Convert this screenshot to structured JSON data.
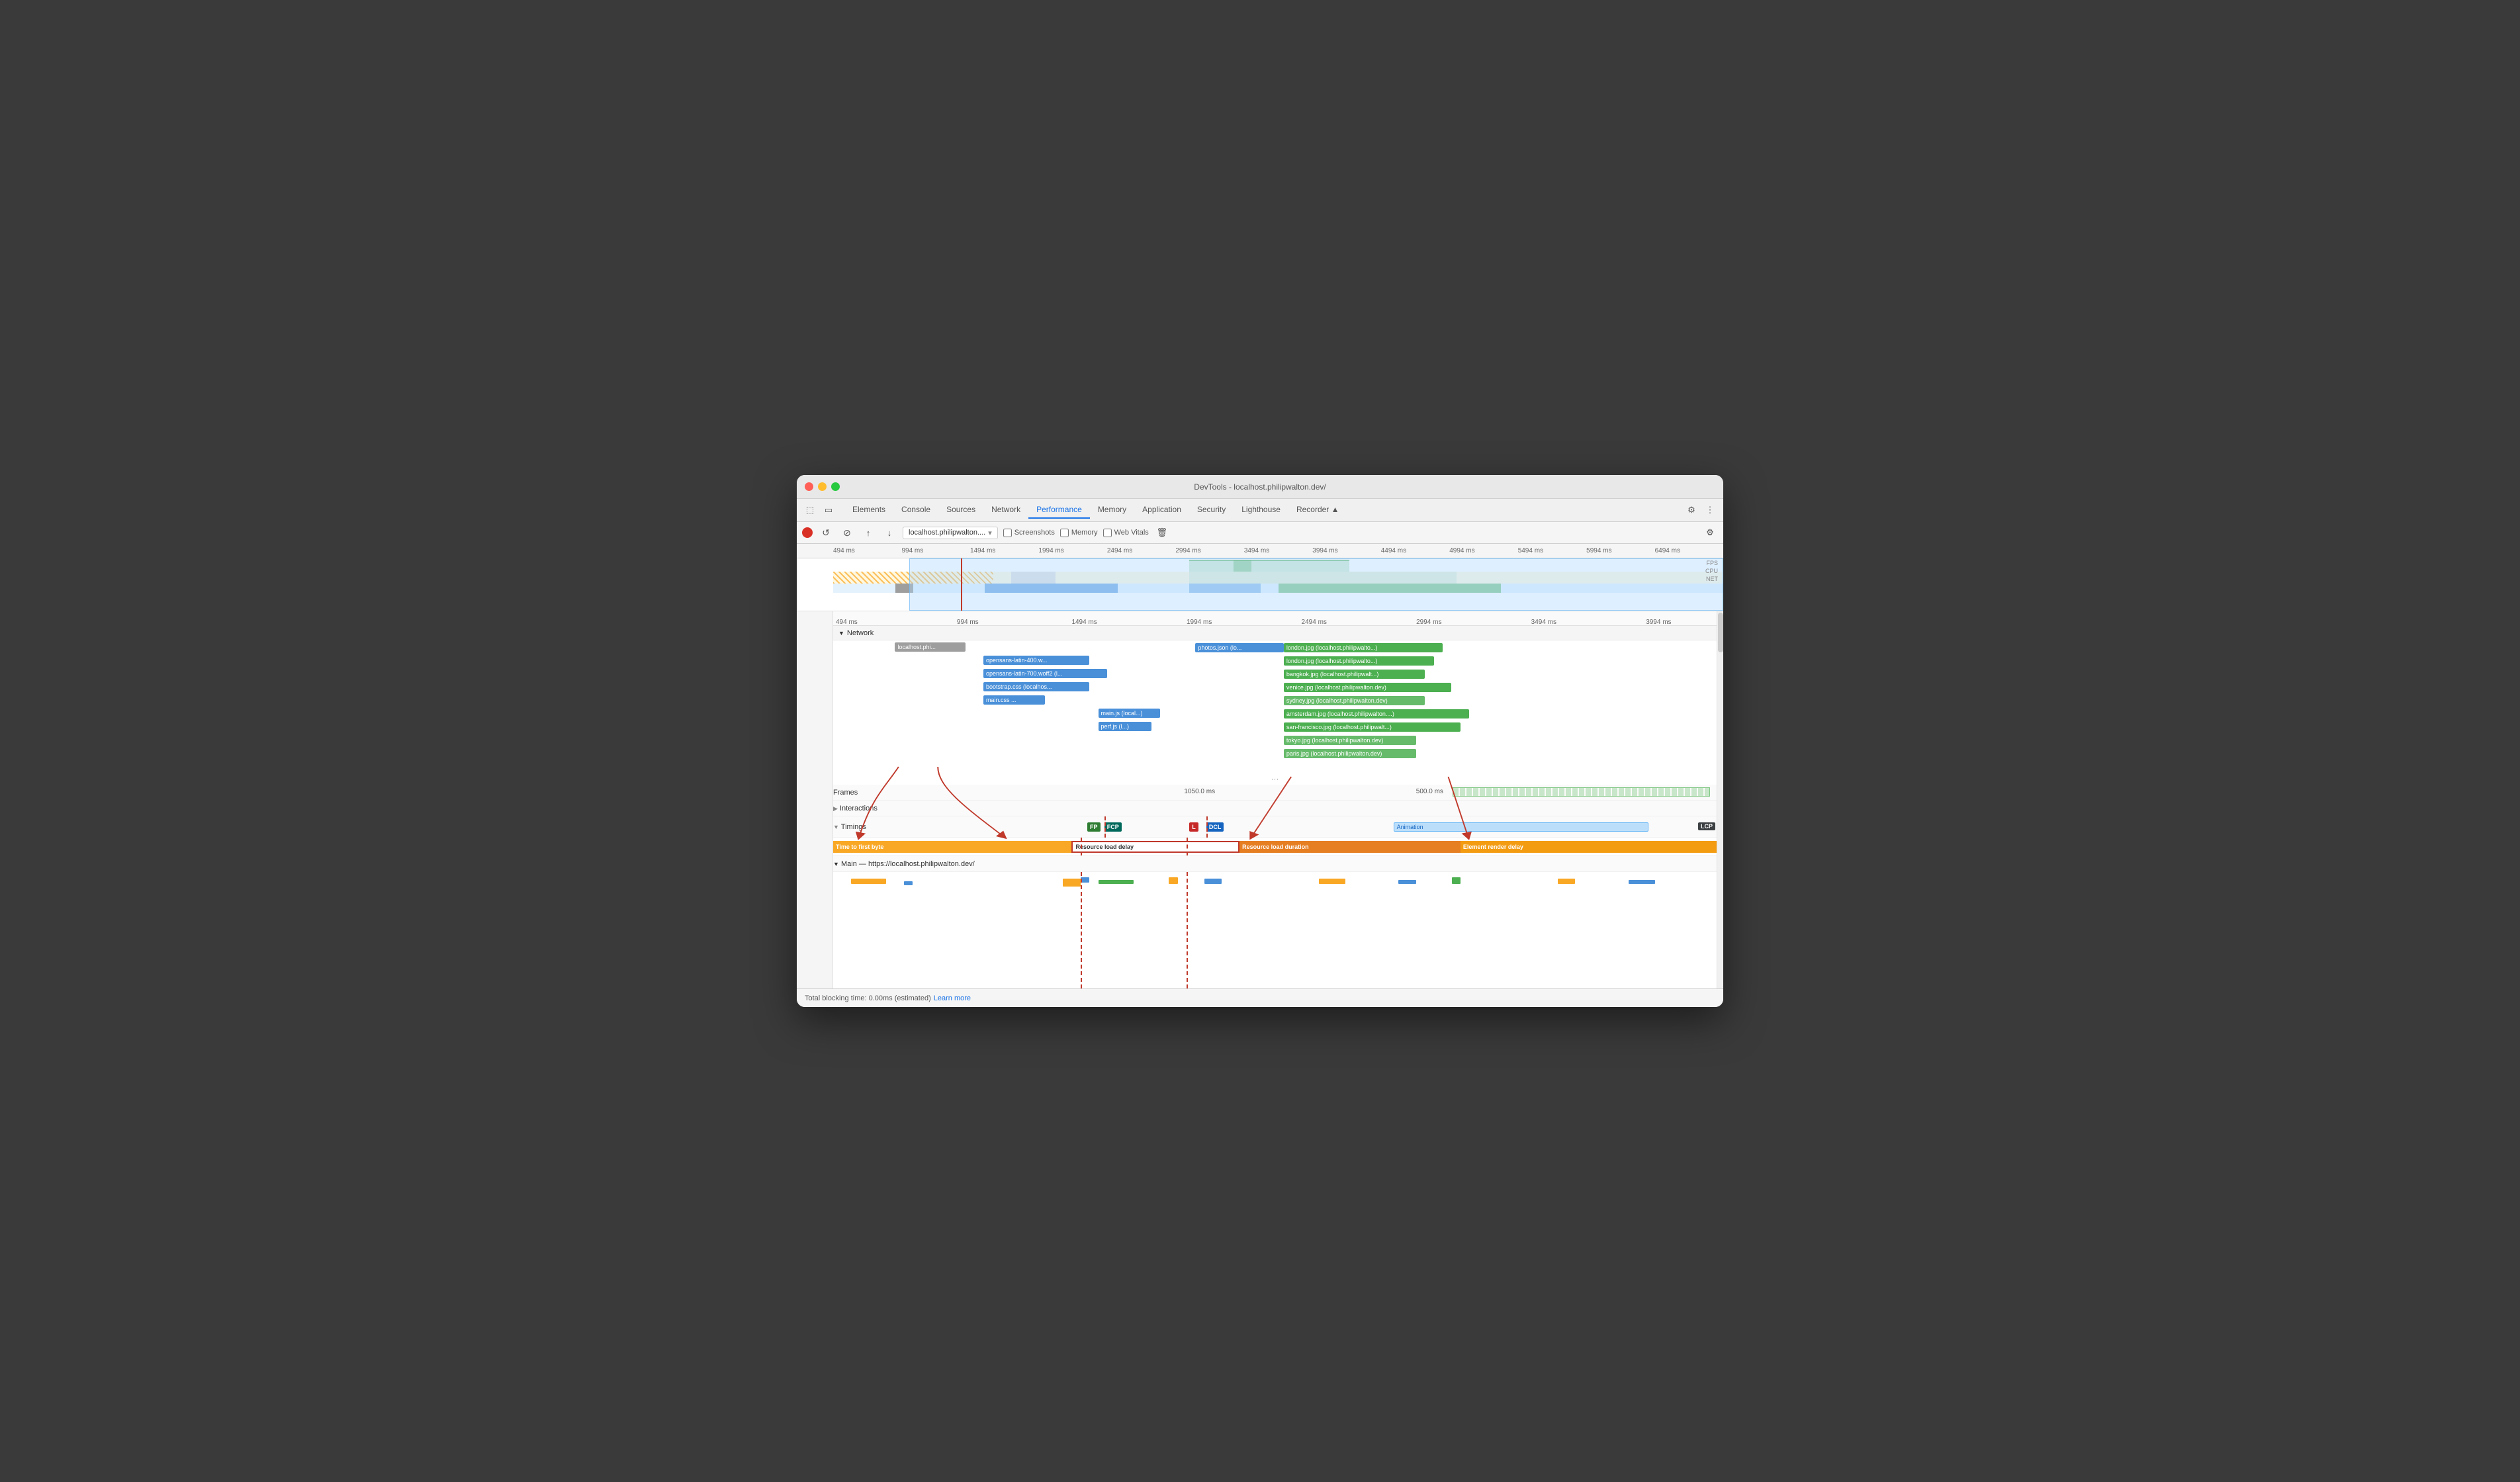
{
  "window": {
    "title": "DevTools - localhost.philipwalton.dev/"
  },
  "toolbar": {
    "tabs": [
      {
        "id": "elements",
        "label": "Elements"
      },
      {
        "id": "console",
        "label": "Console"
      },
      {
        "id": "sources",
        "label": "Sources"
      },
      {
        "id": "network",
        "label": "Network"
      },
      {
        "id": "performance",
        "label": "Performance",
        "active": true
      },
      {
        "id": "memory",
        "label": "Memory"
      },
      {
        "id": "application",
        "label": "Application"
      },
      {
        "id": "security",
        "label": "Security"
      },
      {
        "id": "lighthouse",
        "label": "Lighthouse"
      },
      {
        "id": "recorder",
        "label": "Recorder ▲"
      }
    ]
  },
  "record_bar": {
    "url": "localhost.philipwalton....",
    "screenshots_label": "Screenshots",
    "memory_label": "Memory",
    "web_vitals_label": "Web Vitals"
  },
  "ruler": {
    "labels": [
      "494 ms",
      "994 ms",
      "1494 ms",
      "1994 ms",
      "2494 ms",
      "2994 ms",
      "3494 ms",
      "3994 ms",
      "4494 ms",
      "4994 ms",
      "5494 ms",
      "5994 ms",
      "6494 ms"
    ]
  },
  "ruler2": {
    "labels": [
      "494 ms",
      "994 ms",
      "1494 ms",
      "1994 ms",
      "2494 ms",
      "2994 ms",
      "3494 ms",
      "3994 ms"
    ]
  },
  "overview_labels": [
    "FPS",
    "CPU",
    "NET"
  ],
  "network": {
    "label": "Network",
    "rows": [
      {
        "label": "localhost.phi...",
        "color": "gray",
        "left_pct": 7,
        "width_pct": 9
      },
      {
        "label": "opensans-latin-400.w...",
        "color": "blue",
        "left_pct": 17,
        "width_pct": 12
      },
      {
        "label": "opensans-latin-700.woff2 (l...",
        "color": "blue",
        "left_pct": 17,
        "width_pct": 15
      },
      {
        "label": "bootstrap.css (localhos...",
        "color": "blue",
        "left_pct": 17,
        "width_pct": 13
      },
      {
        "label": "main.css ...",
        "color": "blue",
        "left_pct": 17,
        "width_pct": 8
      },
      {
        "label": "main.js (local...)",
        "color": "blue",
        "left_pct": 30,
        "width_pct": 8
      },
      {
        "label": "perf.js (l...)",
        "color": "blue",
        "left_pct": 30,
        "width_pct": 7
      },
      {
        "label": "photos.json (lo...",
        "color": "blue",
        "left_pct": 41,
        "width_pct": 12
      },
      {
        "label": "london.jpg (localhost.philipwalto...)",
        "color": "green",
        "left_pct": 51,
        "width_pct": 20
      },
      {
        "label": "london.jpg (localhost.philipwalto...)",
        "color": "green",
        "left_pct": 51,
        "width_pct": 18
      },
      {
        "label": "bangkok.jpg (localhost.philipwalt...)",
        "color": "green",
        "left_pct": 51,
        "width_pct": 17
      },
      {
        "label": "venice.jpg (localhost.philipwalton.dev)",
        "color": "green",
        "left_pct": 51,
        "width_pct": 20
      },
      {
        "label": "sydney.jpg (localhost.philipwalton.dev)",
        "color": "lightgreen",
        "left_pct": 51,
        "width_pct": 17
      },
      {
        "label": "amsterdam.jpg (localhost.philipwalton....)",
        "color": "green",
        "left_pct": 51,
        "width_pct": 22
      },
      {
        "label": "san-francisco.jpg (localhost.philipwalt...)",
        "color": "green",
        "left_pct": 51,
        "width_pct": 21
      },
      {
        "label": "tokyo.jpg (localhost.philipwalton.dev)",
        "color": "lightgreen",
        "left_pct": 51,
        "width_pct": 18
      },
      {
        "label": "paris.jpg (localhost.philipwalton.dev)",
        "color": "lightgreen",
        "left_pct": 51,
        "width_pct": 17
      }
    ]
  },
  "perf_sections": {
    "frames_label": "Frames",
    "frames_time1": "1050.0 ms",
    "frames_time2": "500.0 ms",
    "interactions_label": "Interactions",
    "timings_label": "Timings",
    "timing_markers": [
      {
        "label": "FP",
        "color": "green"
      },
      {
        "label": "FCP",
        "color": "teal"
      },
      {
        "label": "L",
        "color": "red"
      },
      {
        "label": "DCL",
        "color": "blue"
      },
      {
        "label": "LCP",
        "color": "dark"
      }
    ],
    "animation_label": "Animation",
    "lcp_bars": [
      {
        "label": "Time to first byte",
        "color": "yellow"
      },
      {
        "label": "Resource load delay",
        "color": "red-outline"
      },
      {
        "label": "Resource load duration",
        "color": "orange"
      },
      {
        "label": "Element render delay",
        "color": "orange-light"
      }
    ],
    "main_label": "Main — https://localhost.philipwalton.dev/"
  },
  "status_bar": {
    "text": "Total blocking time: 0.00ms (estimated)",
    "learn_more": "Learn more"
  }
}
